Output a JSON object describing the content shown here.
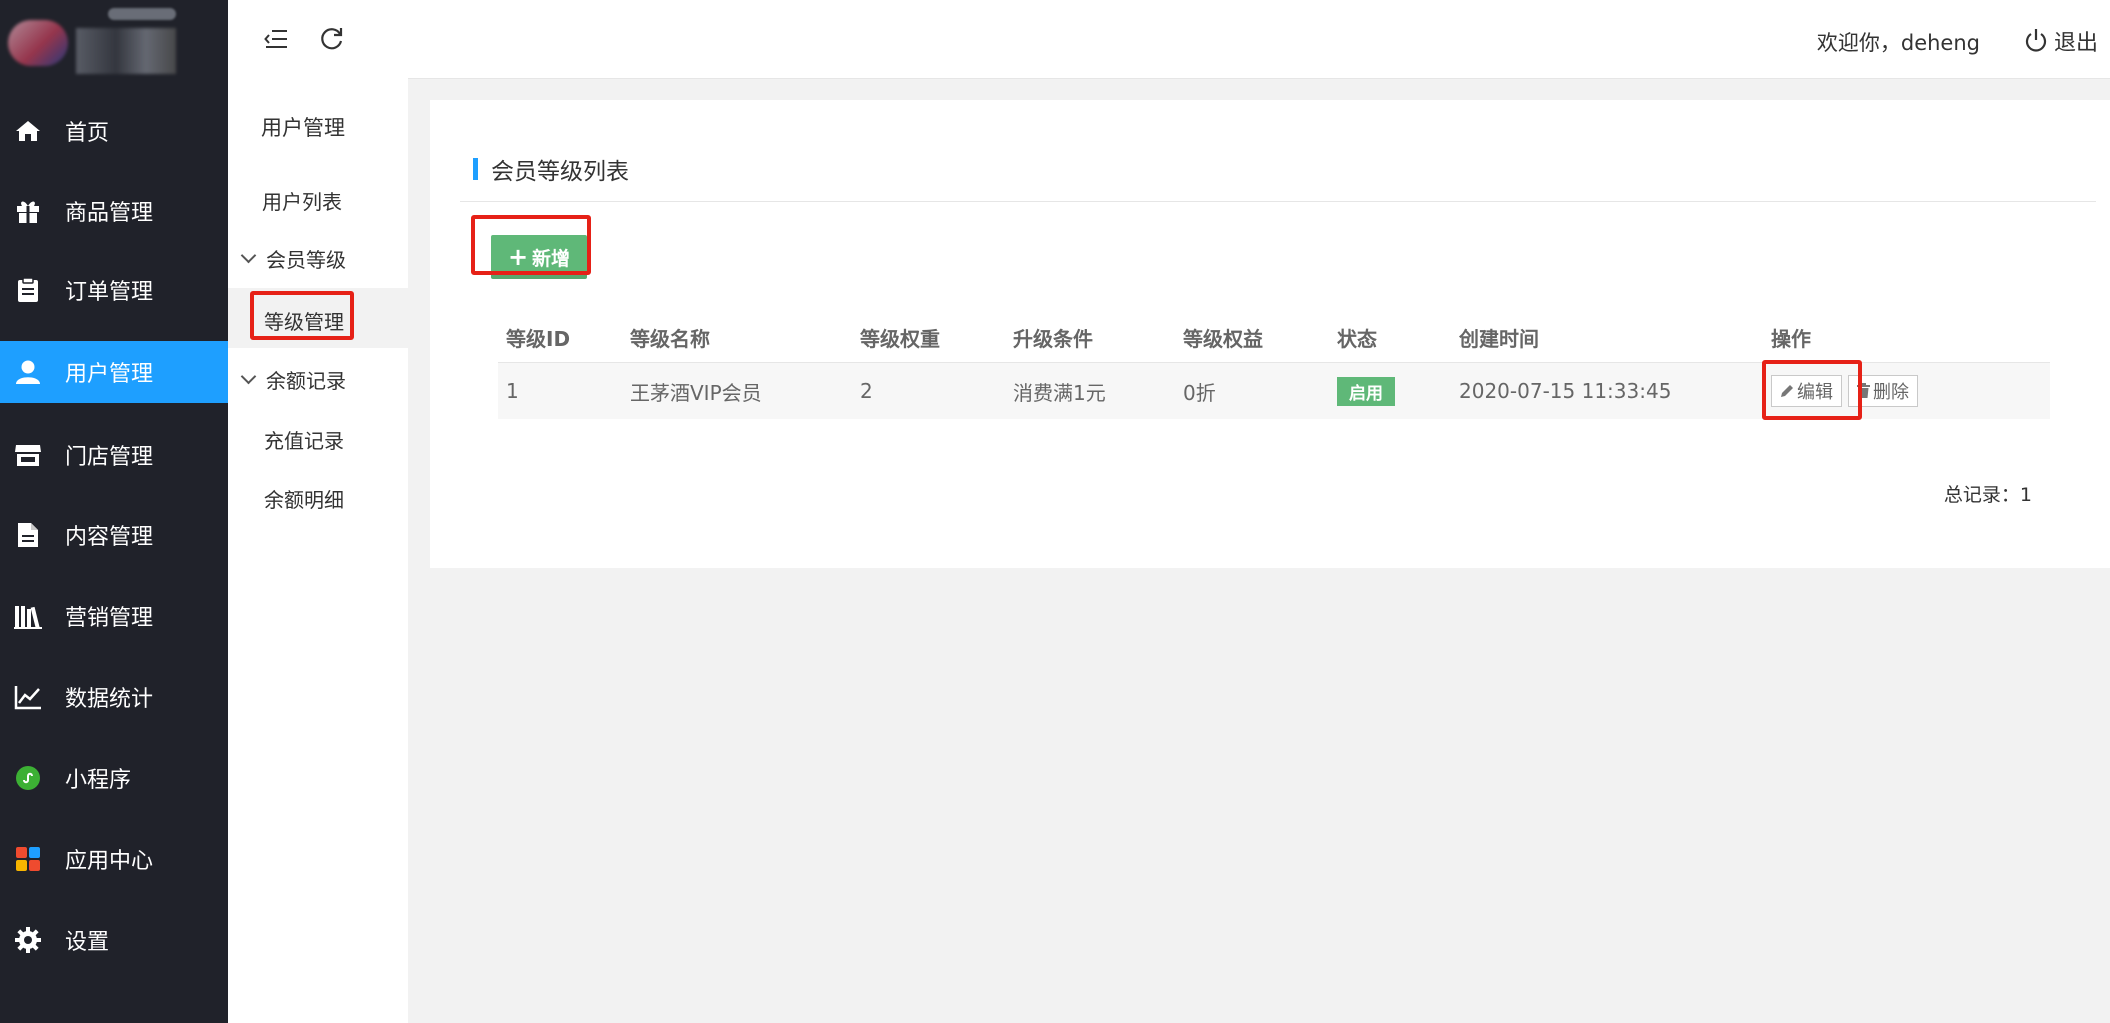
{
  "topbar": {
    "welcome": "欢迎你，deheng",
    "logout": "退出"
  },
  "sidebar": {
    "items": [
      {
        "label": "首页",
        "icon": "home-icon"
      },
      {
        "label": "商品管理",
        "icon": "gift-icon"
      },
      {
        "label": "订单管理",
        "icon": "clipboard-icon"
      },
      {
        "label": "用户管理",
        "icon": "user-icon",
        "active": true
      },
      {
        "label": "门店管理",
        "icon": "store-icon"
      },
      {
        "label": "内容管理",
        "icon": "file-icon"
      },
      {
        "label": "营销管理",
        "icon": "books-icon"
      },
      {
        "label": "数据统计",
        "icon": "line-chart-icon"
      },
      {
        "label": "小程序",
        "icon": "miniprogram-icon"
      },
      {
        "label": "应用中心",
        "icon": "apps-icon"
      },
      {
        "label": "设置",
        "icon": "gear-icon"
      }
    ]
  },
  "submenu": {
    "title": "用户管理",
    "user_list": "用户列表",
    "member_level_group": "会员等级",
    "level_manage": "等级管理",
    "balance_group": "余额记录",
    "recharge_record": "充值记录",
    "balance_detail": "余额明细"
  },
  "main": {
    "title": "会员等级列表",
    "add_label": "新增",
    "table": {
      "headers": [
        "等级ID",
        "等级名称",
        "等级权重",
        "升级条件",
        "等级权益",
        "状态",
        "创建时间",
        "操作"
      ],
      "rows": [
        {
          "id": "1",
          "name": "王茅酒VIP会员",
          "weight": "2",
          "condition": "消费满1元",
          "benefit": "0折",
          "status": "启用",
          "created": "2020-07-15 11:33:45"
        }
      ],
      "edit_label": "编辑",
      "delete_label": "删除"
    },
    "total": "总记录：1"
  },
  "colors": {
    "sidebar_bg": "#20222a",
    "accent": "#1e9fff",
    "success": "#5fb878",
    "highlight": "#e62117"
  }
}
